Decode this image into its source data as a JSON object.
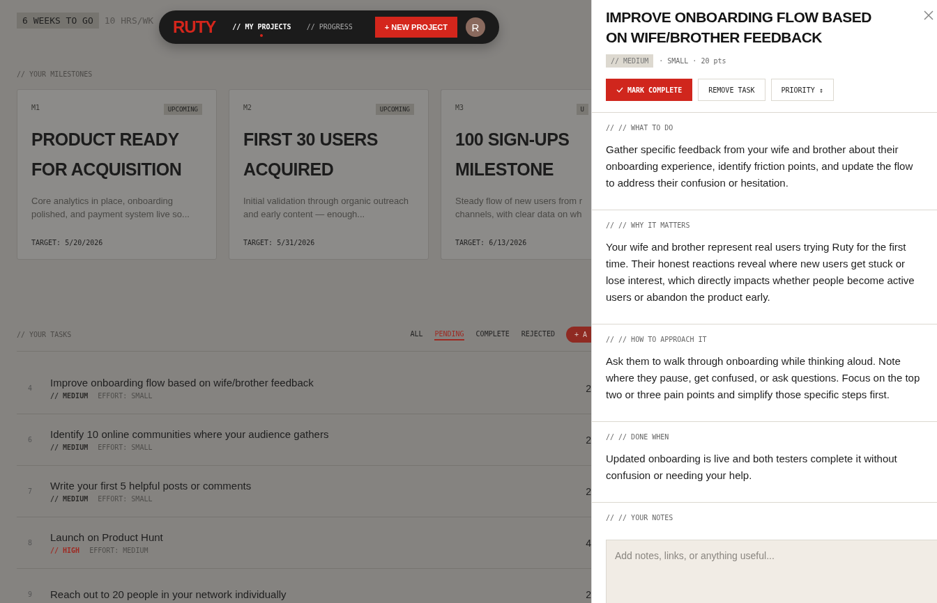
{
  "header": {
    "weeks_badge": "6 WEEKS TO GO",
    "hours": "10 HRS/WK"
  },
  "nav": {
    "logo": "RUTY",
    "tabs": [
      {
        "label": "// MY PROJECTS",
        "selected": true
      },
      {
        "label": "// PROGRESS",
        "selected": false
      }
    ],
    "new_button": "+ NEW PROJECT",
    "avatar": "R"
  },
  "milestones": {
    "heading": "// YOUR MILESTONES",
    "items": [
      {
        "code": "M1",
        "status": "UPCOMING",
        "title": "PRODUCT READY FOR ACQUISITION",
        "description": "Core analytics in place, onboarding polished, and payment system live so...",
        "target": "TARGET: 5/20/2026"
      },
      {
        "code": "M2",
        "status": "UPCOMING",
        "title": "FIRST 30 USERS ACQUIRED",
        "description": "Initial validation through organic outreach and early content — enough...",
        "target": "TARGET: 5/31/2026"
      },
      {
        "code": "M3",
        "status": "U",
        "title": "100 SIGN-UPS MILESTONE",
        "description": "Steady flow of new users from r channels, with clear data on wh",
        "target": "TARGET: 6/13/2026"
      }
    ]
  },
  "tasks": {
    "heading": "// YOUR TASKS",
    "filters": [
      {
        "label": "ALL",
        "selected": false
      },
      {
        "label": "PENDING",
        "selected": true
      },
      {
        "label": "COMPLETE",
        "selected": false
      },
      {
        "label": "REJECTED",
        "selected": false
      }
    ],
    "add_button": "+ A",
    "rows": [
      {
        "number": "4",
        "title": "Improve onboarding flow based on wife/brother feedback",
        "priority": "// MEDIUM",
        "kind": "medium",
        "effort": "EFFORT: SMALL",
        "column_3": "2"
      },
      {
        "number": "6",
        "title": "Identify 10 online communities where your audience gathers",
        "priority": "// MEDIUM",
        "kind": "medium",
        "effort": "EFFORT: SMALL",
        "column_3": "2"
      },
      {
        "number": "7",
        "title": "Write your first 5 helpful posts or comments",
        "priority": "// MEDIUM",
        "kind": "medium",
        "effort": "EFFORT: SMALL",
        "column_3": "2"
      },
      {
        "number": "8",
        "title": "Launch on Product Hunt",
        "priority": "// HIGH",
        "kind": "high",
        "effort": "EFFORT: MEDIUM",
        "column_3": "4"
      },
      {
        "number": "9",
        "title": "Reach out to 20 people in your network individually",
        "column_3": "2"
      }
    ]
  },
  "panel": {
    "title": "IMPROVE ONBOARDING FLOW BASED ON WIFE/BROTHER FEEDBACK",
    "priority_badge": "// MEDIUM",
    "meta": "· SMALL · 20 pts",
    "buttons": [
      {
        "label": "MARK COMPLETE",
        "kind": "primary"
      },
      {
        "label": "REMOVE TASK",
        "kind": "secondary"
      },
      {
        "label": "PRIORITY ↕",
        "kind": "secondary"
      }
    ],
    "sections": [
      {
        "label": "// // WHAT TO DO",
        "text": "Gather specific feedback from your wife and brother about their onboarding experience, identify friction points, and update the flow to address their confusion or hesitation."
      },
      {
        "label": "// // WHY IT MATTERS",
        "text": "Your wife and brother represent real users trying Ruty for the first time. Their honest reactions reveal where new users get stuck or lose interest, which directly impacts whether people become active users or abandon the product early."
      },
      {
        "label": "// // HOW TO APPROACH IT",
        "text": "Ask them to walk through onboarding while thinking aloud. Note where they pause, get confused, or ask questions. Focus on the top two or three pain points and simplify those specific steps first."
      },
      {
        "label": "// // DONE WHEN",
        "text": "Updated onboarding is live and both testers complete it without confusion or needing your help."
      }
    ],
    "notes": {
      "label": "// // YOUR NOTES",
      "placeholder": "Add notes, links, or anything useful..."
    }
  }
}
